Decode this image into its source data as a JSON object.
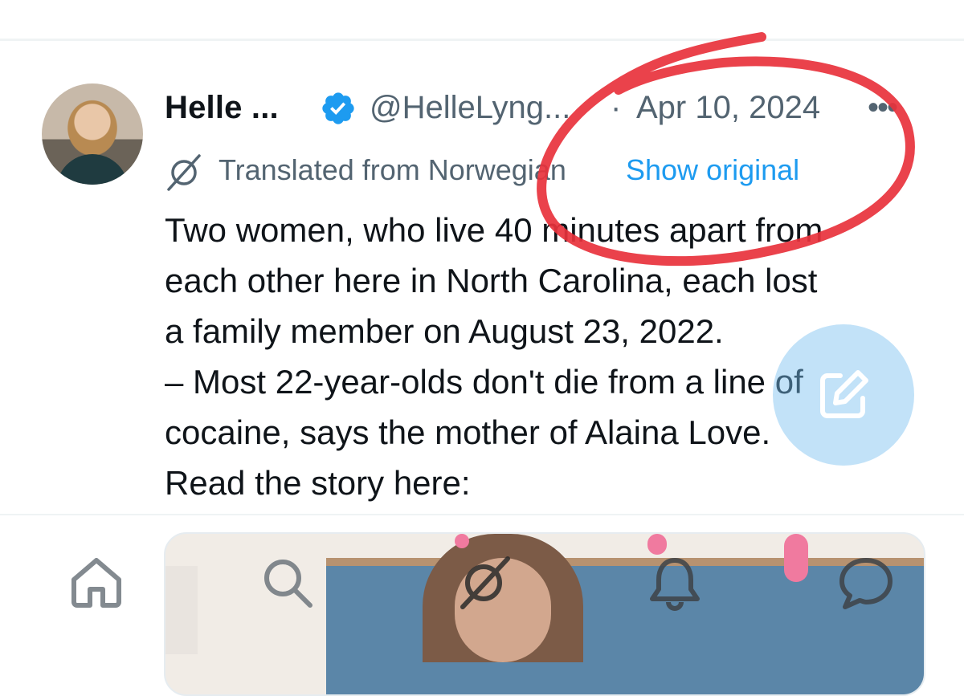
{
  "tweet": {
    "author_name": "Helle ...",
    "handle": "@HelleLyng...",
    "separator": "·",
    "date": "Apr 10, 2024",
    "more_label": "•••",
    "translation_note": "Translated from Norwegian",
    "show_original_label": "Show original",
    "body_lines": [
      "Two women, who live 40 minutes apart from",
      "each other here in North Carolina, each lost",
      "a family member on August 23, 2022.",
      "– Most 22-year-olds don't die from a line of",
      "cocaine, says the mother of Alaina Love.",
      "Read the story here:"
    ]
  },
  "colors": {
    "link": "#1d9bf0",
    "secondary_text": "#536471",
    "verified": "#1d9bf0",
    "annotation": "#e8323c"
  },
  "icons": {
    "verified": "verified-badge-icon",
    "translate": "translate-icon",
    "home": "home-icon",
    "search": "search-icon",
    "grok": "grok-icon",
    "notifications": "bell-icon",
    "messages": "message-icon",
    "compose": "compose-icon"
  }
}
